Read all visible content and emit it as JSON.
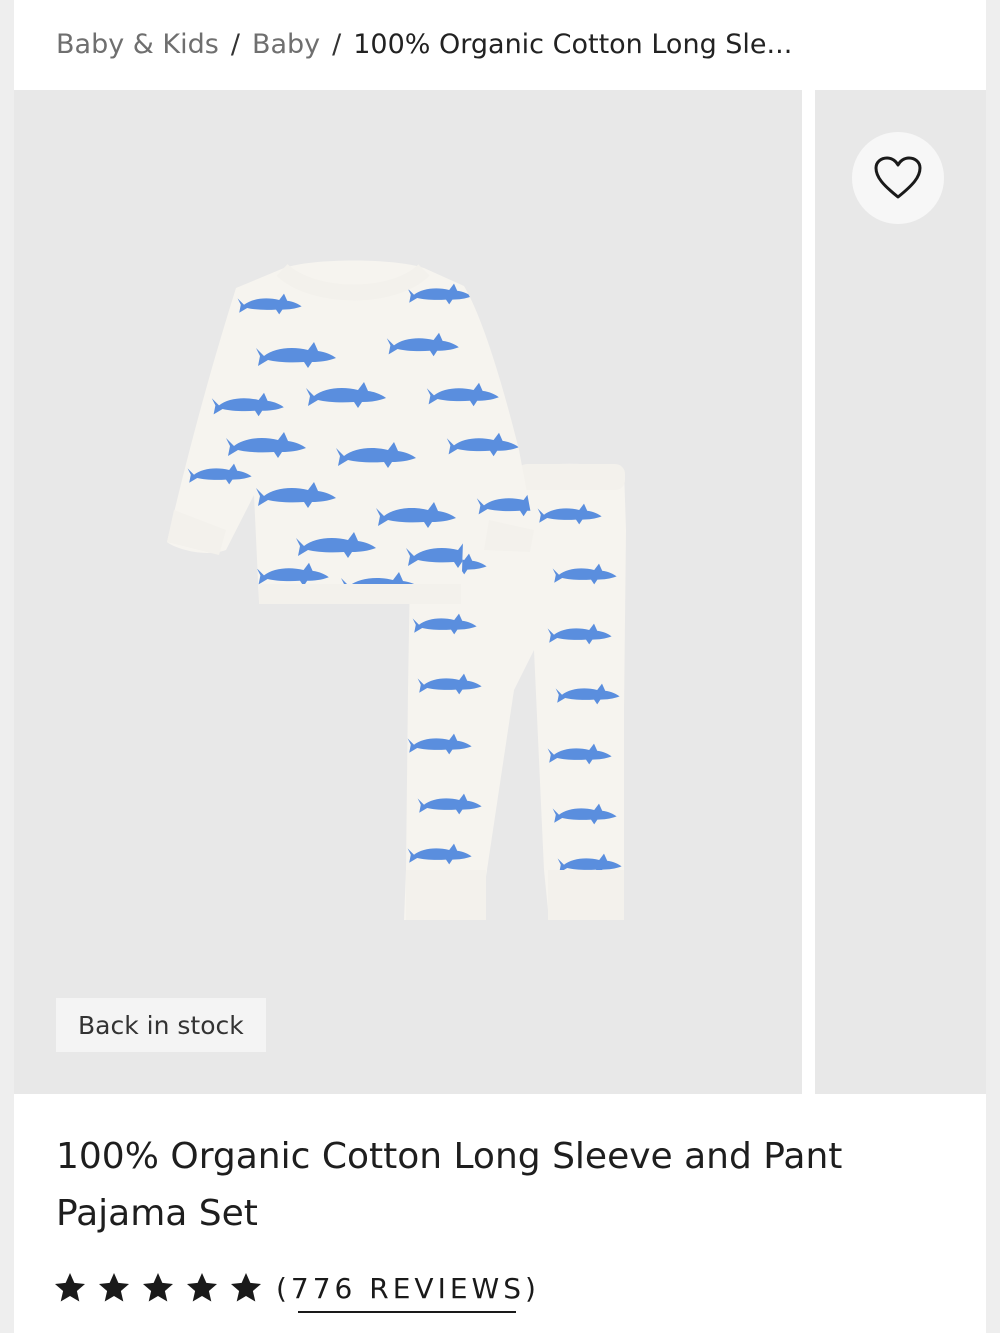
{
  "breadcrumb": {
    "items": [
      "Baby & Kids",
      "Baby"
    ],
    "separator": "/",
    "current": "100% Organic Cotton Long Sle..."
  },
  "gallery": {
    "badge": "Back in stock",
    "wishlist_icon": "heart-outline-icon",
    "image_colors": {
      "fabric": "#f6f4ef",
      "print": "#5a8ede",
      "background": "#e8e8e8"
    }
  },
  "product": {
    "title": "100% Organic Cotton Long Sleeve and Pant Pajama Set",
    "rating": 5,
    "reviews_label": "(776 REVIEWS)"
  }
}
